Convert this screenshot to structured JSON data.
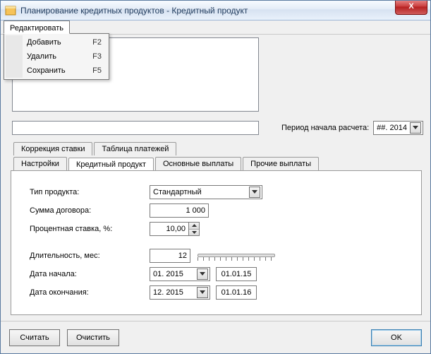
{
  "window": {
    "title": "Планирование кредитных продуктов - Кредитный продукт",
    "close_symbol": "X"
  },
  "menu": {
    "edit_label": "Редактировать",
    "items": [
      {
        "label": "Добавить",
        "hotkey": "F2"
      },
      {
        "label": "Удалить",
        "hotkey": "F3"
      },
      {
        "label": "Сохранить",
        "hotkey": "F5"
      }
    ]
  },
  "period": {
    "label": "Период начала расчета:",
    "value": "##. 2014"
  },
  "tabs_row1": [
    {
      "label": "Коррекция ставки"
    },
    {
      "label": "Таблица платежей"
    }
  ],
  "tabs_row2": [
    {
      "label": "Настройки"
    },
    {
      "label": "Кредитный продукт"
    },
    {
      "label": "Основные выплаты"
    },
    {
      "label": "Прочие выплаты"
    }
  ],
  "form": {
    "product_type_label": "Тип продукта:",
    "product_type_value": "Стандартный",
    "amount_label": "Сумма договора:",
    "amount_value": "1 000",
    "rate_label": "Процентная ставка, %:",
    "rate_value": "10,00",
    "duration_label": "Длительность, мес:",
    "duration_value": "12",
    "start_label": "Дата начала:",
    "start_month": "01. 2015",
    "start_date": "01.01.15",
    "end_label": "Дата окончания:",
    "end_month": "12. 2015",
    "end_date": "01.01.16"
  },
  "buttons": {
    "calc": "Считать",
    "clear": "Очистить",
    "ok": "OK"
  }
}
